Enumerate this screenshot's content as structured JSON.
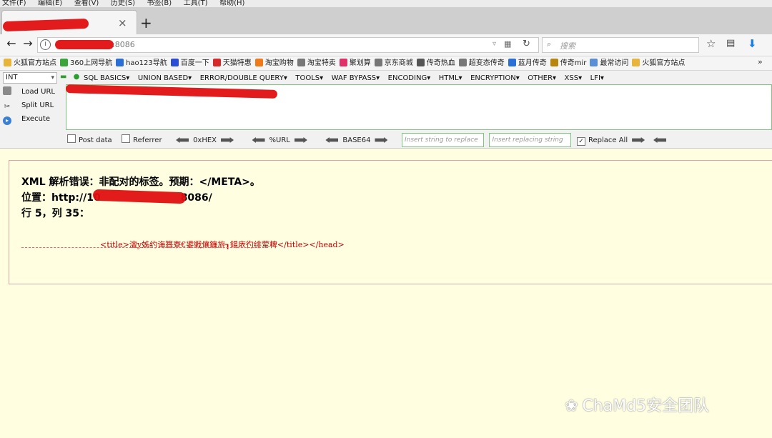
{
  "menubar": [
    "文件(F)",
    "编辑(E)",
    "查看(V)",
    "历史(S)",
    "书签(B)",
    "工具(T)",
    "帮助(H)"
  ],
  "tab": {
    "label": "",
    "close": "×",
    "new_tab": "+"
  },
  "navbar": {
    "back": "←",
    "forward": "→",
    "info": "i",
    "url": ":8086",
    "dropdown": "▿",
    "qr": "▦",
    "reload": "↻",
    "search_placeholder": "搜索",
    "search_icon": "⌕",
    "star": "☆",
    "clip": "▤",
    "download": "⬇"
  },
  "bookmarks": [
    {
      "label": "火狐官方站点",
      "icon": "folder-icon",
      "color": "#e8b43a"
    },
    {
      "label": "360上网导航",
      "icon": "360-icon",
      "color": "#3aa63a"
    },
    {
      "label": "hao123导航",
      "icon": "hao123-icon",
      "color": "#2a6fd6"
    },
    {
      "label": "百度一下",
      "icon": "baidu-icon",
      "color": "#2a4fd6"
    },
    {
      "label": "天猫特惠",
      "icon": "tmall-icon",
      "color": "#d62a2a"
    },
    {
      "label": "淘宝购物",
      "icon": "taobao-icon",
      "color": "#f07a1a"
    },
    {
      "label": "淘宝特卖",
      "icon": "globe-icon",
      "color": "#777777"
    },
    {
      "label": "聚划算",
      "icon": "juhuasuan-icon",
      "color": "#e0306a"
    },
    {
      "label": "京东商城",
      "icon": "globe-icon",
      "color": "#777777"
    },
    {
      "label": "传奇热血",
      "icon": "game-icon",
      "color": "#555555"
    },
    {
      "label": "超变态传奇",
      "icon": "globe-icon",
      "color": "#777777"
    },
    {
      "label": "蓝月传奇",
      "icon": "game-icon",
      "color": "#2a6fd6"
    },
    {
      "label": "传奇mir",
      "icon": "game-icon",
      "color": "#b8860b"
    },
    {
      "label": "最常访问",
      "icon": "bookmark-icon",
      "color": "#5a8fd6"
    },
    {
      "label": "火狐官方站点",
      "icon": "folder-icon",
      "color": "#e8b43a"
    }
  ],
  "bookmarks_more": "»",
  "hackbar": {
    "select_value": "INT",
    "select_arrow": "▾",
    "dots": "▬ ●",
    "menus": [
      "SQL BASICS▾",
      "UNION BASED▾",
      "ERROR/DOUBLE QUERY▾",
      "TOOLS▾",
      "WAF BYPASS▾",
      "ENCODING▾",
      "HTML▾",
      "ENCRYPTION▾",
      "OTHER▾",
      "XSS▾",
      "LFI▾"
    ],
    "load_url": "Load URL",
    "split_url": "Split URL",
    "execute": "Execute",
    "post_data": "Post data",
    "referrer": "Referrer",
    "hex": "0xHEX",
    "url_enc": "%URL",
    "base64": "BASE64",
    "insert_placeholder": "Insert string to replace",
    "replacing_placeholder": "Insert replacing string",
    "replace_all": "Replace All",
    "replace_all_checked": "✓"
  },
  "error": {
    "title": "XML 解析错误：非配对的标签。预期：</META>。",
    "location_prefix": "位置：http://10",
    "location_suffix": "8086/",
    "line": "行 5，列 35：",
    "source": "<title>澶у姊约诲簭寮€鍙戦儴鐮旂┒鍚庡彴绯荤粺</title></head>"
  },
  "watermark": "ChaMd5安全团队",
  "watermark_icon": "❀"
}
